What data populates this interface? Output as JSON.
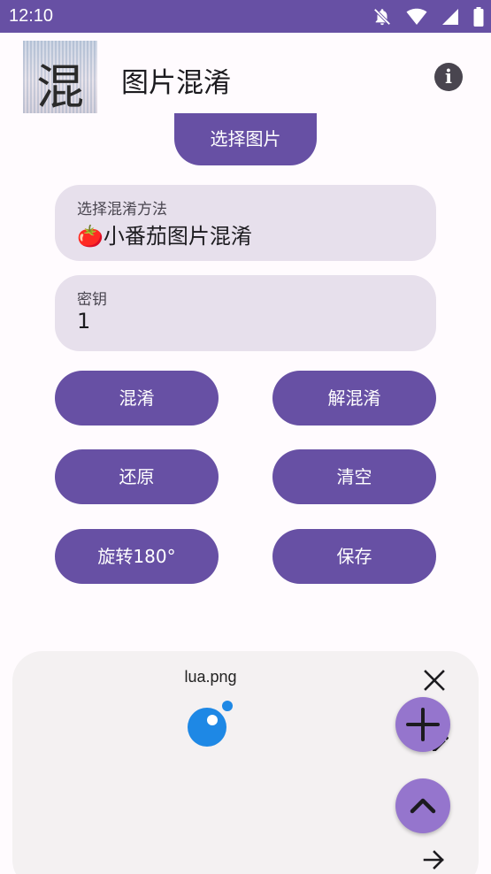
{
  "status_bar": {
    "time": "12:10",
    "icons": [
      "notifications-off-icon",
      "wifi-icon",
      "cellular-signal-icon",
      "battery-icon"
    ]
  },
  "app_bar": {
    "logo_char": "混",
    "title": "图片混淆",
    "info_icon": "info-icon"
  },
  "actions": {
    "pick_image": "选择图片",
    "obfuscate": "混淆",
    "deobfuscate": "解混淆",
    "restore": "还原",
    "clear": "清空",
    "rotate": "旋转180°",
    "save": "保存"
  },
  "method_field": {
    "label": "选择混淆方法",
    "value": "🍅小番茄图片混淆"
  },
  "key_field": {
    "label": "密钥",
    "value": "1"
  },
  "floating_panel": {
    "filename": "lua.png",
    "icons": [
      "lua-logo-icon",
      "close-icon",
      "edit-icon",
      "add-icon",
      "chevron-up-icon",
      "arrow-right-icon"
    ]
  },
  "colors": {
    "primary": "#6750a4",
    "surface": "#fffbfe",
    "field_background": "#e7e0ec",
    "panel_background": "#f4f1f2",
    "fab_background": "#9575cd",
    "lua_blue": "#1e88e5"
  }
}
